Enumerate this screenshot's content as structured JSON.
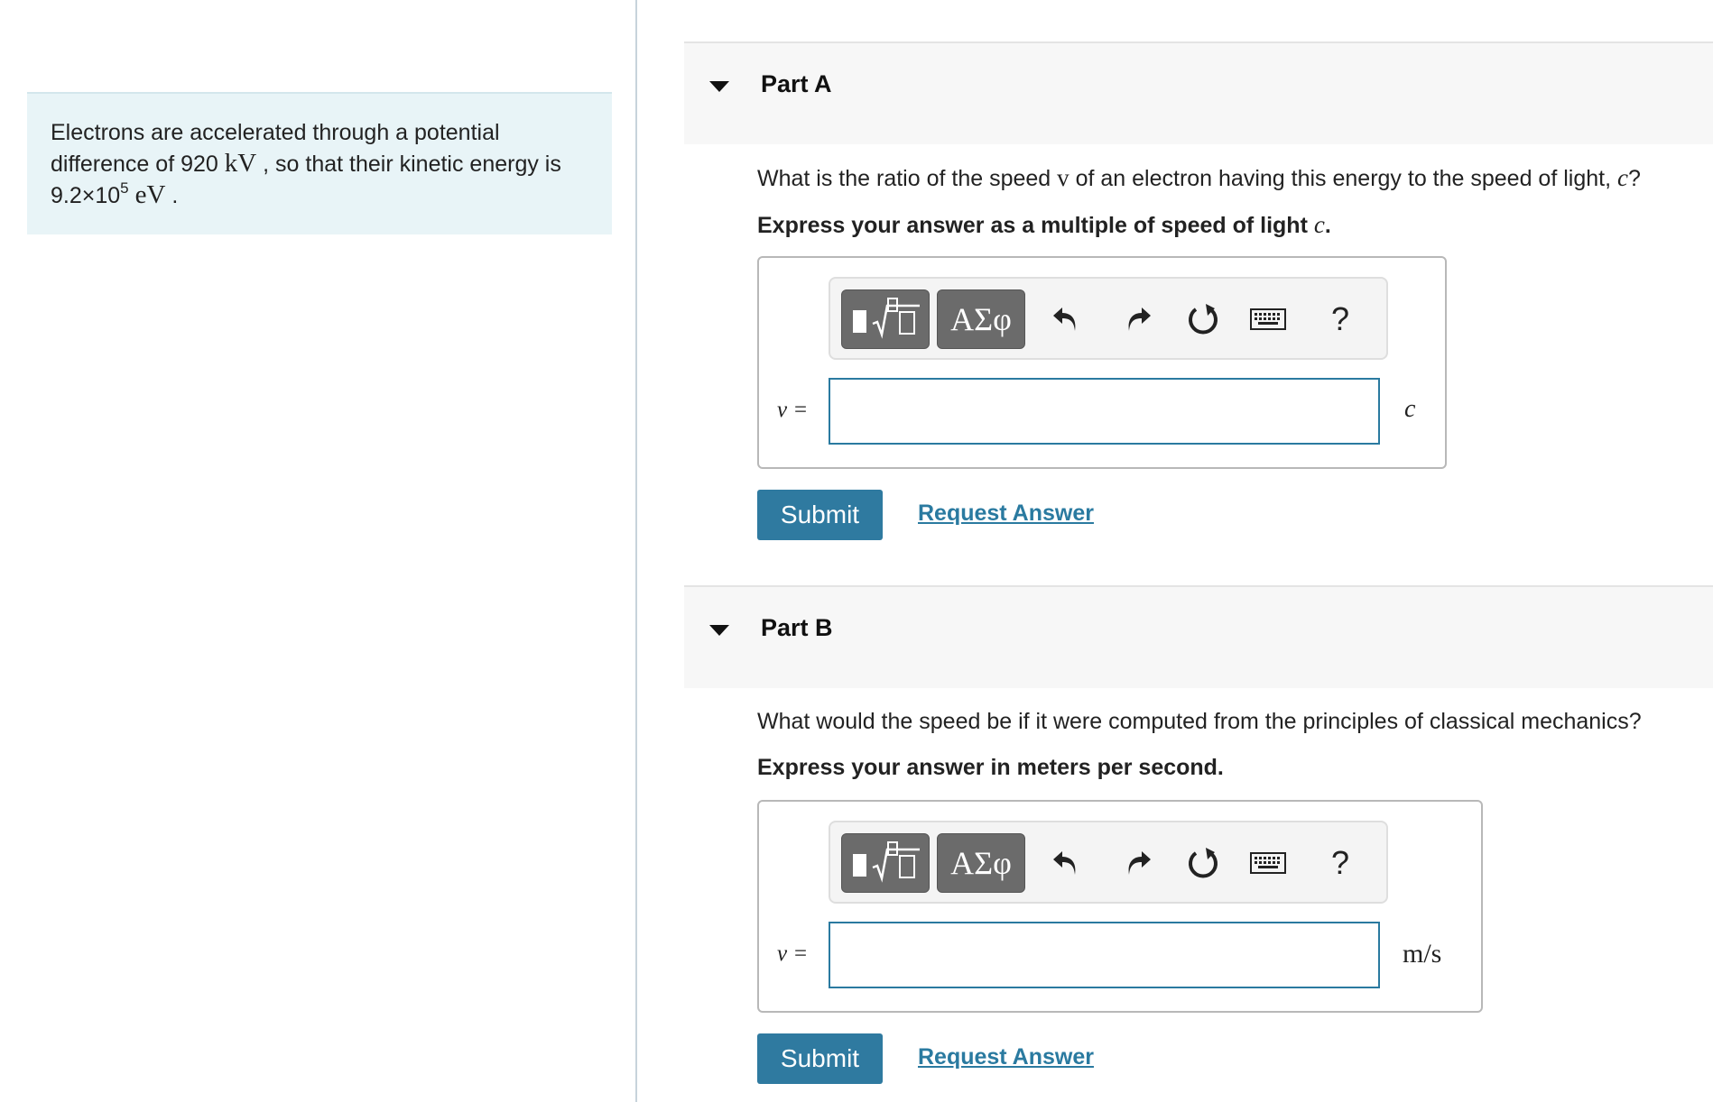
{
  "intro": {
    "text1": "Electrons are accelerated through a potential difference of 920 ",
    "unit_kv": "kV",
    "text2": " , so that their kinetic energy is",
    "value_mantissa": "9.2×10",
    "value_exp": "5",
    "unit_ev": "eV",
    "text3": " ."
  },
  "toolbar": {
    "templates_icon": "templates-sqrt-icon",
    "symbols_label": "ΑΣφ",
    "undo_icon": "undo-icon",
    "redo_icon": "redo-icon",
    "reset_icon": "reset-icon",
    "keyboard_icon": "keyboard-icon",
    "help_label": "?"
  },
  "parts": [
    {
      "title": "Part A",
      "question_pre": "What is the ratio of the speed ",
      "question_var": "v",
      "question_post": " of an electron having this energy to the speed of light, ",
      "question_c": "c",
      "question_end": "?",
      "instruction_pre": "Express your answer as a multiple of speed of light ",
      "instruction_c": "c",
      "instruction_end": ".",
      "var_label": "v =",
      "input_value": "",
      "unit": "c",
      "submit_label": "Submit",
      "request_label": "Request Answer"
    },
    {
      "title": "Part B",
      "question_pre": "What would the speed be if it were computed from the principles of classical mechanics?",
      "instruction_pre": "Express your answer in meters per second.",
      "var_label": "v =",
      "input_value": "",
      "unit": "m/s",
      "submit_label": "Submit",
      "request_label": "Request Answer"
    }
  ],
  "colors": {
    "accent": "#2f7aa0",
    "intro_bg": "#e8f4f7",
    "header_bg": "#f7f7f7"
  }
}
